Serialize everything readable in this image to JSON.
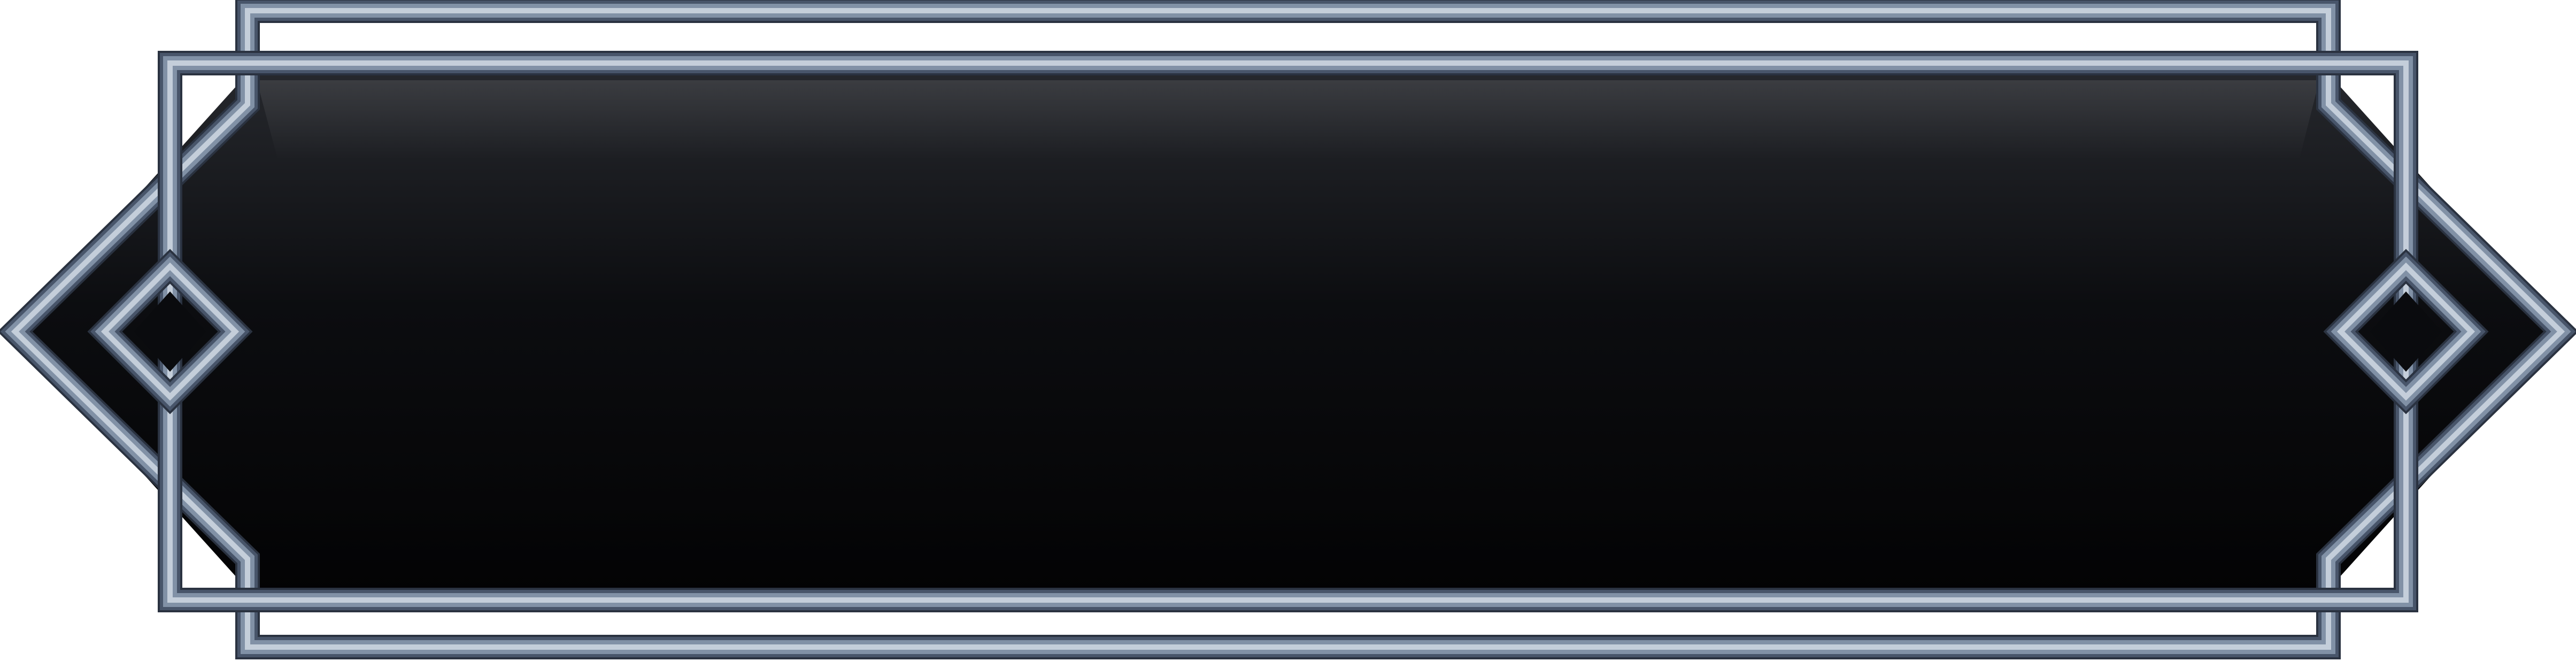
{
  "panel": {
    "style": "ornate-metal-frame",
    "content_text": ""
  },
  "colors": {
    "frame_light": "#c4ceda",
    "frame_mid": "#8191a6",
    "frame_dark": "#48556a",
    "frame_shadow": "#2a3240",
    "fill_top": "#26282d",
    "fill_bottom": "#030304",
    "background": "#ffffff"
  }
}
